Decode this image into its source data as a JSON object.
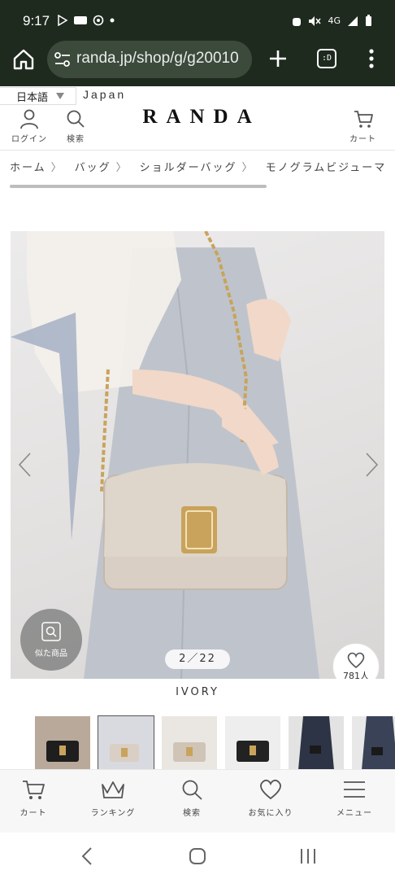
{
  "status_bar": {
    "time": "9:17",
    "network": "4G",
    "icons": [
      "play-store-icon",
      "pass-icon",
      "sync-icon",
      "dot-icon",
      "wifi-off-icon",
      "mute-icon",
      "signal-icon",
      "battery-icon"
    ]
  },
  "browser": {
    "url": "randa.jp/shop/g/g20010",
    "tabs_label": ":D"
  },
  "header": {
    "language": "日本語",
    "region": "Japan",
    "logo": "RANDA",
    "login_label": "ログイン",
    "search_label": "検索",
    "cart_label": "カート"
  },
  "breadcrumb": {
    "items": [
      "ホーム",
      "バッグ",
      "ショルダーバッグ",
      "モノグラムビジューマ"
    ],
    "separator": "〉"
  },
  "product": {
    "similar_label": "似た商品",
    "image_counter": "2／22",
    "favorite_count": "781人",
    "color_name": "IVORY",
    "thumbnails": [
      "thumb-1",
      "thumb-2",
      "thumb-3",
      "thumb-4",
      "thumb-5",
      "thumb-6"
    ],
    "selected_thumbnail": 2
  },
  "bottom_nav": {
    "items": [
      {
        "label": "カート",
        "icon": "cart-icon"
      },
      {
        "label": "ランキング",
        "icon": "crown-icon"
      },
      {
        "label": "検索",
        "icon": "search-icon"
      },
      {
        "label": "お気に入り",
        "icon": "heart-icon"
      },
      {
        "label": "メニュー",
        "icon": "hamburger-icon"
      }
    ]
  },
  "colors": {
    "system_bar": "#1f2a1f",
    "url_box": "#3c4a3c",
    "bag": "#d9cfc4",
    "accent_gold": "#c9a35c"
  }
}
